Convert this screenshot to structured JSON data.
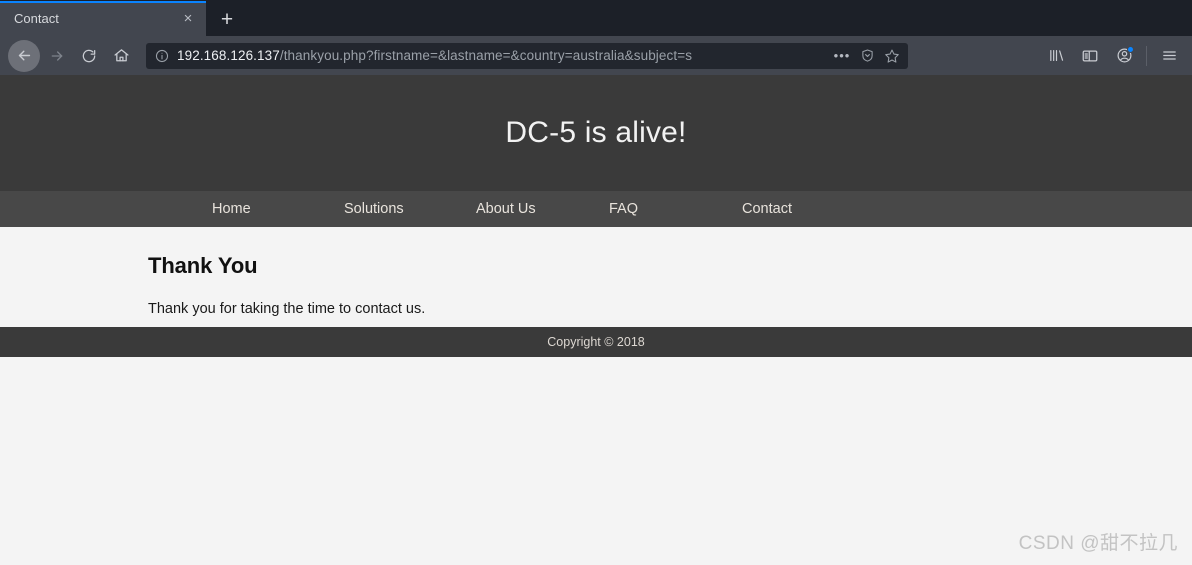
{
  "browser": {
    "tab": {
      "title": "Contact",
      "close_label": "×",
      "accent_color": "#0a84ff"
    },
    "newtab_label": "+",
    "nav_buttons": [
      {
        "name": "back-button",
        "label": "←"
      },
      {
        "name": "forward-button",
        "label": "→"
      },
      {
        "name": "reload-button",
        "label": "↻"
      },
      {
        "name": "home-button",
        "label": "⌂"
      }
    ],
    "urlbar": {
      "host": "192.168.126.137",
      "path": "/thankyou.php?firstname=&lastname=&country=australia&subject=s",
      "full_url": "192.168.126.137/thankyou.php?firstname=&lastname=&country=australia&subject=s",
      "info_icon": "site-info-icon",
      "page_actions_label": "•••",
      "shield_icon": "shield-icon",
      "bookmark_icon": "star-icon"
    },
    "toolbar_icons": [
      {
        "name": "library-icon"
      },
      {
        "name": "sidebar-icon"
      },
      {
        "name": "account-icon",
        "has_badge": true
      },
      {
        "name": "app-menu-icon"
      }
    ]
  },
  "page": {
    "header": {
      "title": "DC-5 is alive!"
    },
    "nav": [
      {
        "label": "Home"
      },
      {
        "label": "Solutions"
      },
      {
        "label": "About Us"
      },
      {
        "label": "FAQ"
      },
      {
        "label": "Contact"
      }
    ],
    "main": {
      "heading": "Thank You",
      "body": "Thank you for taking the time to contact us."
    },
    "footer": {
      "copyright": "Copyright © 2018"
    }
  },
  "watermark": {
    "text": "CSDN @甜不拉几"
  }
}
